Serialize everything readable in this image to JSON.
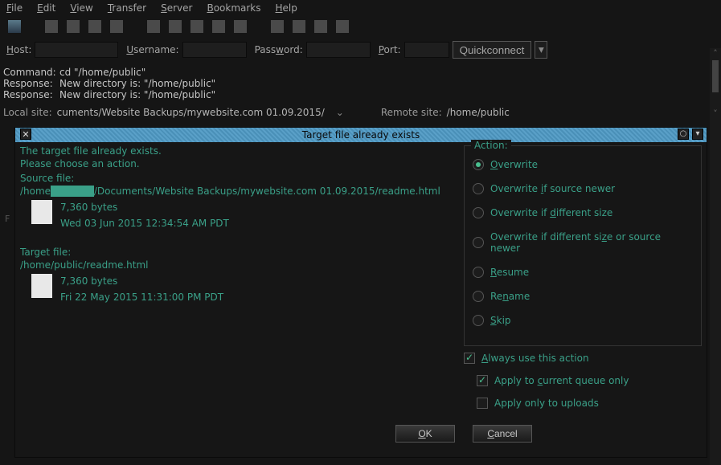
{
  "menu": [
    "File",
    "Edit",
    "View",
    "Transfer",
    "Server",
    "Bookmarks",
    "Help"
  ],
  "conn": {
    "host_label": "Host:",
    "user_label": "Username:",
    "pass_label": "Password:",
    "port_label": "Port:",
    "quickconnect": "Quickconnect"
  },
  "log": [
    {
      "label": "Command:",
      "value": "cd \"/home/public\""
    },
    {
      "label": "Response:",
      "value": "New directory is: \"/home/public\""
    },
    {
      "label": "Response:",
      "value": "New directory is: \"/home/public\""
    }
  ],
  "sites": {
    "local_label": "Local site:",
    "local_path": "cuments/Website Backups/mywebsite.com 01.09.2015/",
    "remote_label": "Remote site:",
    "remote_path": "/home/public"
  },
  "dialog": {
    "title": "Target file already exists",
    "msg1": "The target file already exists.",
    "msg2": "Please choose an action.",
    "source_label": "Source file:",
    "source_path_prefix": "/home",
    "source_path_suffix": "/Documents/Website Backups/mywebsite.com 01.09.2015/readme.html",
    "source_size": "7,360 bytes",
    "source_date": "Wed 03 Jun 2015 12:34:54 AM PDT",
    "target_label": "Target file:",
    "target_path": "/home/public/readme.html",
    "target_size": "7,360 bytes",
    "target_date": "Fri 22 May 2015 11:31:00 PM PDT",
    "action_label": "Action:",
    "options": {
      "overwrite": "Overwrite",
      "newer": "Overwrite if source newer",
      "diffsize": "Overwrite if different size",
      "diffornewer": "Overwrite if different size or source newer",
      "resume": "Resume",
      "rename": "Rename",
      "skip": "Skip"
    },
    "always": "Always use this action",
    "apply_queue": "Apply to current queue only",
    "apply_uploads": "Apply only to uploads",
    "ok": "OK",
    "cancel": "Cancel"
  }
}
